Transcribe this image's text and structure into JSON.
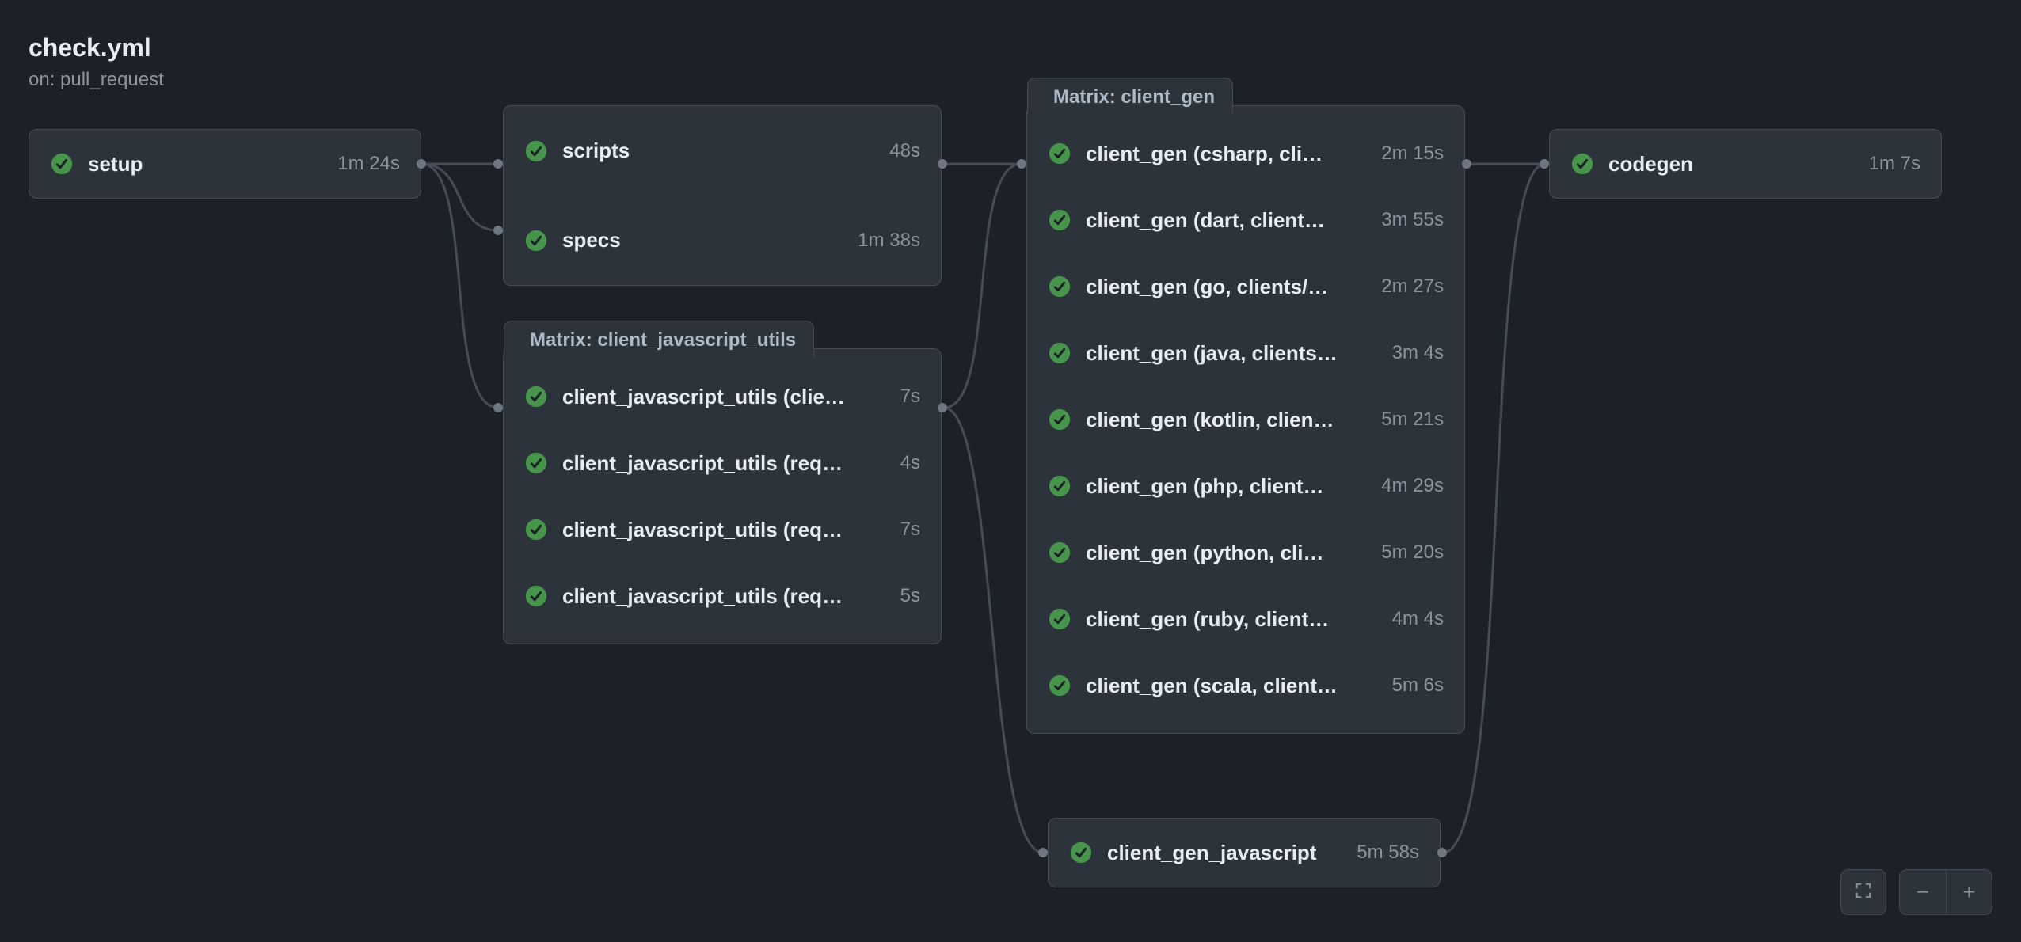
{
  "workflow": {
    "title": "check.yml",
    "subtitle": "on: pull_request"
  },
  "jobs": {
    "setup": {
      "name": "setup",
      "duration": "1m 24s",
      "status": "success"
    },
    "scripts": {
      "name": "scripts",
      "duration": "48s",
      "status": "success"
    },
    "specs": {
      "name": "specs",
      "duration": "1m 38s",
      "status": "success"
    },
    "client_gen_javascript": {
      "name": "client_gen_javascript",
      "duration": "5m 58s",
      "status": "success"
    },
    "codegen": {
      "name": "codegen",
      "duration": "1m 7s",
      "status": "success"
    }
  },
  "matrix_js": {
    "label": "Matrix: client_javascript_utils",
    "rows": [
      {
        "name": "client_javascript_utils (clie…",
        "duration": "7s",
        "status": "success"
      },
      {
        "name": "client_javascript_utils (req…",
        "duration": "4s",
        "status": "success"
      },
      {
        "name": "client_javascript_utils (req…",
        "duration": "7s",
        "status": "success"
      },
      {
        "name": "client_javascript_utils (req…",
        "duration": "5s",
        "status": "success"
      }
    ]
  },
  "matrix_gen": {
    "label": "Matrix: client_gen",
    "rows": [
      {
        "name": "client_gen (csharp, cli…",
        "duration": "2m 15s",
        "status": "success"
      },
      {
        "name": "client_gen (dart, client…",
        "duration": "3m 55s",
        "status": "success"
      },
      {
        "name": "client_gen (go, clients/…",
        "duration": "2m 27s",
        "status": "success"
      },
      {
        "name": "client_gen (java, clients…",
        "duration": "3m 4s",
        "status": "success"
      },
      {
        "name": "client_gen (kotlin, clien…",
        "duration": "5m 21s",
        "status": "success"
      },
      {
        "name": "client_gen (php, client…",
        "duration": "4m 29s",
        "status": "success"
      },
      {
        "name": "client_gen (python, cli…",
        "duration": "5m 20s",
        "status": "success"
      },
      {
        "name": "client_gen (ruby, client…",
        "duration": "4m 4s",
        "status": "success"
      },
      {
        "name": "client_gen (scala, client…",
        "duration": "5m 6s",
        "status": "success"
      }
    ]
  },
  "zoom": {
    "fullscreen": "⛶",
    "minus": "−",
    "plus": "+"
  }
}
